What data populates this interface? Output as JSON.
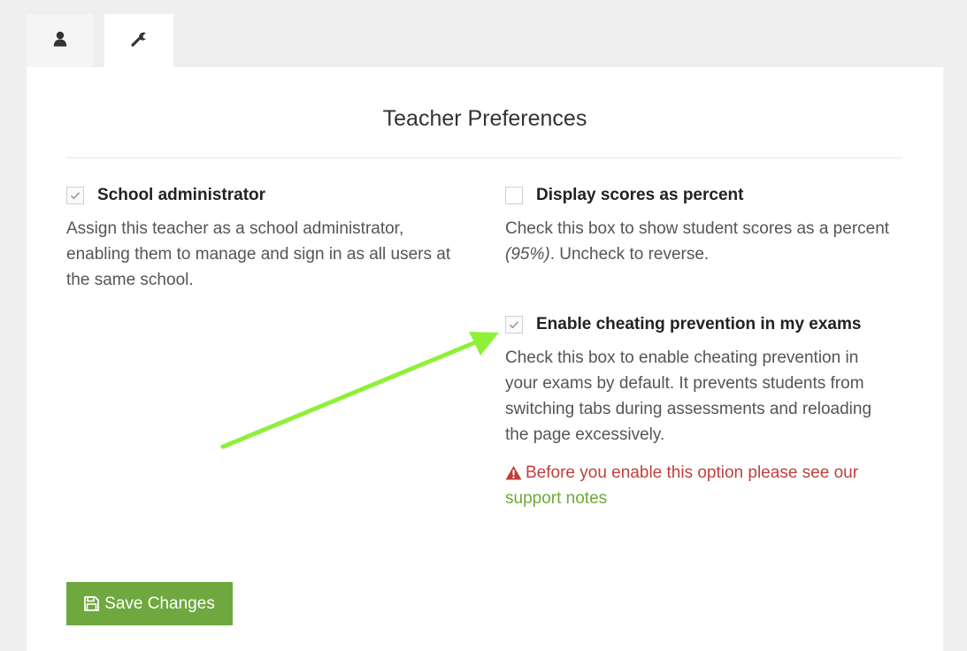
{
  "tabs": [
    {
      "icon": "user-icon",
      "active": false
    },
    {
      "icon": "wrench-icon",
      "active": true
    }
  ],
  "page_title": "Teacher Preferences",
  "options": {
    "school_admin": {
      "checked": true,
      "label": "School administrator",
      "description": "Assign this teacher as a school administrator, enabling them to manage and sign in as all users at the same school."
    },
    "scores_percent": {
      "checked": false,
      "label": "Display scores as percent",
      "description_before": "Check this box to show student scores as a percent ",
      "description_example": "(95%)",
      "description_after": ". Uncheck to reverse."
    },
    "cheating_prevention": {
      "checked": true,
      "label": "Enable cheating prevention in my exams",
      "description": "Check this box to enable cheating prevention in your exams by default. It prevents students from switching tabs during assessments and reloading the page excessively.",
      "warning_text": "Before you enable this option please see our ",
      "warning_link": "support notes"
    }
  },
  "save_button": {
    "label": "Save Changes",
    "icon": "save-icon"
  },
  "colors": {
    "background": "#efefef",
    "panel": "#ffffff",
    "primary_button": "#6ea83f",
    "warning": "#c0403c",
    "link": "#6fa83a",
    "annotation_arrow": "#8ff03a"
  }
}
